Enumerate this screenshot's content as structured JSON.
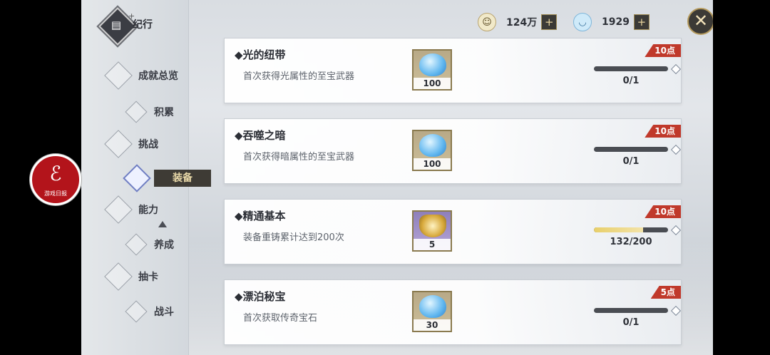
{
  "header": {
    "title": "纪行"
  },
  "nav": {
    "items": [
      "成就总览",
      "积累",
      "挑战",
      "装备",
      "能力",
      "养成",
      "抽卡",
      "战斗"
    ],
    "active": "装备"
  },
  "currency": [
    {
      "icon": "coin-icon",
      "value": "124万"
    },
    {
      "icon": "slime-gem-icon",
      "value": "1929"
    }
  ],
  "close": {
    "symbol": "✕"
  },
  "achievements": [
    {
      "title": "光的纽带",
      "desc": "首次获得光属性的至宝武器",
      "reward_icon": "water-slime-icon",
      "reward_count": "100",
      "points": "10点",
      "progress": "0/1",
      "fill": 0
    },
    {
      "title": "吞噬之暗",
      "desc": "首次获得暗属性的至宝武器",
      "reward_icon": "water-slime-icon",
      "reward_count": "100",
      "points": "10点",
      "progress": "0/1",
      "fill": 0
    },
    {
      "title": "精通基本",
      "desc": "装备重铸累计达到200次",
      "reward_icon": "golden-key-icon",
      "reward_count": "5",
      "points": "10点",
      "progress": "132/200",
      "fill": 0.66
    },
    {
      "title": "漂泊秘宝",
      "desc": "首次获取传奇宝石",
      "reward_icon": "water-slime-icon",
      "reward_count": "30",
      "points": "5点",
      "progress": "0/1",
      "fill": 0
    }
  ],
  "emblem": {
    "text": "游戏日报"
  }
}
